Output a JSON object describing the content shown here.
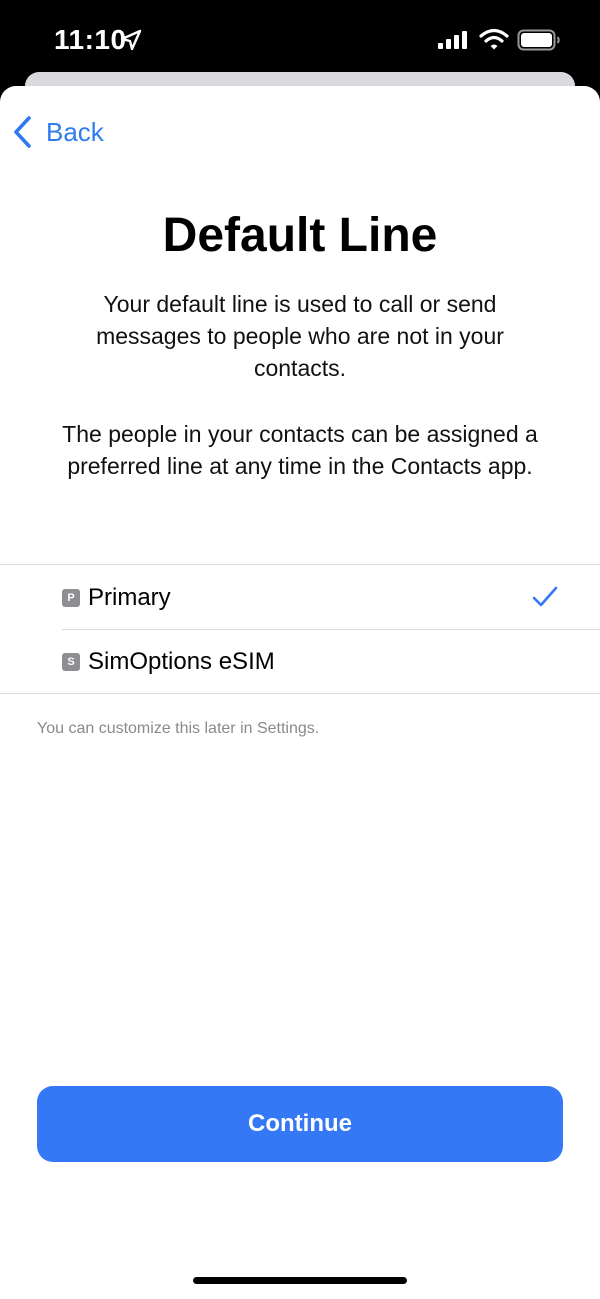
{
  "status_bar": {
    "time": "11:10",
    "icons": [
      "location-arrow-icon",
      "cellular-signal-icon",
      "wifi-icon",
      "battery-icon"
    ]
  },
  "nav": {
    "back_label": "Back",
    "back_icon": "chevron-left-icon"
  },
  "title": "Default Line",
  "description": [
    "Your default line is used to call or send messages to people who are not in your contacts.",
    "The people in your contacts can be assigned a preferred line at any time in the Contacts app."
  ],
  "lines": [
    {
      "badge": "P",
      "label": "Primary",
      "selected": true
    },
    {
      "badge": "S",
      "label": "SimOptions eSIM",
      "selected": false
    }
  ],
  "footnote": "You can customize this later in Settings.",
  "continue_label": "Continue",
  "colors": {
    "accent": "#3478f6",
    "link": "#2f7cf0",
    "badge": "#8e8e93",
    "separator": "#dcdcde",
    "footnote": "#8a8a8e"
  }
}
